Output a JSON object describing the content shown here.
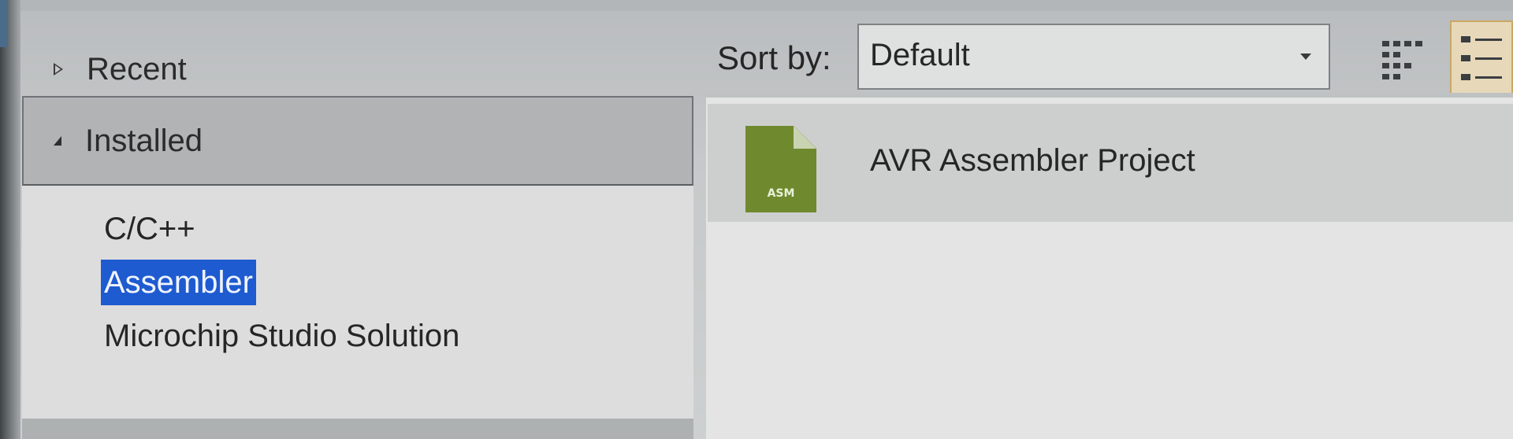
{
  "sidebar": {
    "recent_label": "Recent",
    "installed_label": "Installed",
    "items": [
      {
        "label": "C/C++",
        "selected": false
      },
      {
        "label": "Assembler",
        "selected": true
      },
      {
        "label": "Microchip Studio Solution",
        "selected": false
      }
    ]
  },
  "sort": {
    "label": "Sort by:",
    "value": "Default"
  },
  "view_buttons": {
    "grid_icon": "small-icons-view-icon",
    "list_icon": "list-view-icon",
    "active": "list"
  },
  "templates": [
    {
      "icon_badge": "ASM",
      "name": "AVR Assembler Project",
      "icon_color": "#6f8a2e"
    }
  ],
  "colors": {
    "selection": "#1f5bd0",
    "asm_icon": "#6f8a2e"
  }
}
